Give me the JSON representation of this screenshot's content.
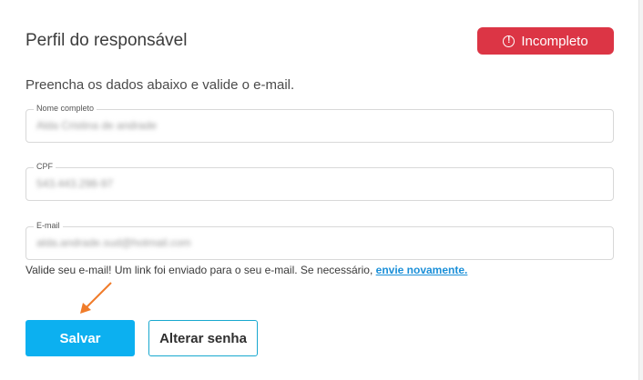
{
  "header": {
    "title": "Perfil do responsável",
    "status_badge": {
      "label": "Incompleto",
      "icon": "exclamation-circle-icon",
      "color": "#dc3545"
    }
  },
  "form": {
    "intro": "Preencha os dados abaixo e valide o e-mail.",
    "fields": [
      {
        "label": "Nome completo",
        "value": "Alda Cristina de andrade"
      },
      {
        "label": "CPF",
        "value": "543.443.298-97"
      },
      {
        "label": "E-mail",
        "value": "alda.andrade.sud@hotmail.com"
      }
    ],
    "email_hint": {
      "text": "Valide seu e-mail! Um link foi enviado para o seu e-mail. Se necessário, ",
      "link": "envie novamente."
    }
  },
  "actions": {
    "save_label": "Salvar",
    "change_password_label": "Alterar senha"
  },
  "colors": {
    "primary": "#0cb0f0",
    "danger": "#dc3545",
    "link": "#1a8fd8",
    "annotation_arrow": "#f07c2a"
  }
}
